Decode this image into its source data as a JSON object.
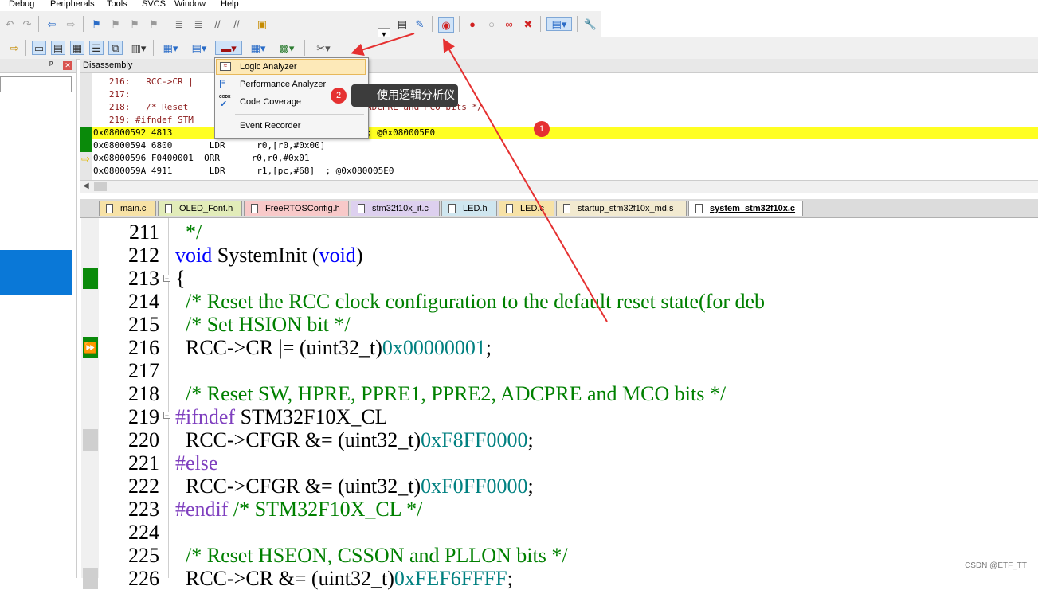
{
  "menubar": {
    "items": [
      "Debug",
      "Peripherals",
      "Tools",
      "SVCS",
      "Window",
      "Help"
    ]
  },
  "left_panel": {
    "pin": "ᵖ",
    "close": "✕"
  },
  "disassembly": {
    "title": "Disassembly",
    "lines": [
      "   216:   RCC->CR |",
      "   217:",
      "   218:   /* Reset",
      "   219: #ifndef STM",
      "0x08000592 4813",
      "0x08000594 6800       LDR      r0,[r0,#0x00]",
      "0x08000596 F0400001  ORR      r0,r0,#0x01",
      "0x0800059A 4911       LDR      r1,[pc,#68]  ; @0x080005E0"
    ],
    "partial_218": "ADCPRE and MCO bits */",
    "partial_0592": "; @0x080005E0"
  },
  "tabs": [
    "main.c",
    "OLED_Font.h",
    "FreeRTOSConfig.h",
    "stm32f10x_it.c",
    "LED.h",
    "LED.c",
    "startup_stm32f10x_md.s",
    "system_stm32f10x.c"
  ],
  "editor": {
    "lines": [
      {
        "n": "211",
        "text": "  */"
      },
      {
        "n": "212",
        "text": "void SystemInit (void)"
      },
      {
        "n": "213",
        "text": "{"
      },
      {
        "n": "214",
        "text": "  /* Reset the RCC clock configuration to the default reset state(for deb"
      },
      {
        "n": "215",
        "text": "  /* Set HSION bit */"
      },
      {
        "n": "216",
        "text": "  RCC->CR |= (uint32_t)0x00000001;"
      },
      {
        "n": "217",
        "text": ""
      },
      {
        "n": "218",
        "text": "  /* Reset SW, HPRE, PPRE1, PPRE2, ADCPRE and MCO bits */"
      },
      {
        "n": "219",
        "text": "#ifndef STM32F10X_CL"
      },
      {
        "n": "220",
        "text": "  RCC->CFGR &= (uint32_t)0xF8FF0000;"
      },
      {
        "n": "221",
        "text": "#else"
      },
      {
        "n": "222",
        "text": "  RCC->CFGR &= (uint32_t)0xF0FF0000;"
      },
      {
        "n": "223",
        "text": "#endif /* STM32F10X_CL */"
      },
      {
        "n": "224",
        "text": ""
      },
      {
        "n": "225",
        "text": "  /* Reset HSEON, CSSON and PLLON bits */"
      },
      {
        "n": "226",
        "text": "  RCC->CR &= (uint32_t)0xFEF6FFFF;"
      }
    ]
  },
  "analysis_menu": {
    "items": [
      {
        "label": "Logic Analyzer",
        "icon": "logic-analyzer-icon"
      },
      {
        "label": "Performance Analyzer",
        "icon": "performance-analyzer-icon"
      },
      {
        "label": "Code Coverage",
        "icon": "code-coverage-icon",
        "icon_text": "CODE"
      },
      {
        "label": "Event Recorder",
        "icon": ""
      }
    ]
  },
  "annotations": {
    "badge1": "1",
    "badge2": "2",
    "tooltip": "使用逻辑分析仪"
  },
  "watermark": "CSDN @ETF_TT",
  "colors": {
    "highlight_line": "#ffff22",
    "selection_blue": "#0a78d7",
    "annotation_red": "#e53131",
    "comment_green": "#008000",
    "keyword_blue": "#0000ff",
    "hex_teal": "#008080"
  }
}
